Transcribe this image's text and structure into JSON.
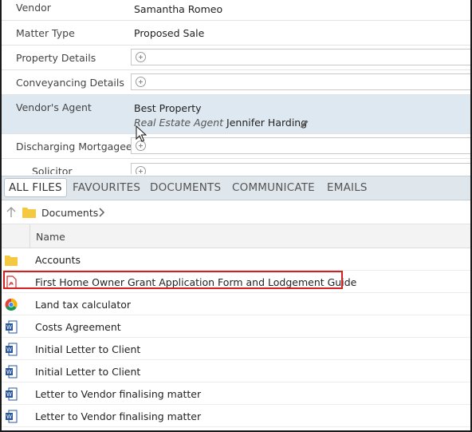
{
  "details": {
    "vendor_label": "Vendor",
    "vendor_value": "Samantha Romeo",
    "matter_type_label": "Matter Type",
    "matter_type_value": "Proposed Sale",
    "property_details_label": "Property Details",
    "conveyancing_details_label": "Conveyancing Details",
    "vendors_agent_label": "Vendor's Agent",
    "vendors_agent_company": "Best Property",
    "vendors_agent_role": "Real Estate Agent",
    "vendors_agent_person": "Jennifer Harding",
    "discharging_mortgagee_label": "Discharging Mortgagee",
    "solicitor_label": "Solicitor"
  },
  "tabs": [
    "ALL FILES",
    "FAVOURITES",
    "DOCUMENTS",
    "COMMUNICATE",
    "EMAILS"
  ],
  "active_tab": "ALL FILES",
  "breadcrumb": {
    "folder": "Documents"
  },
  "table": {
    "name_header": "Name",
    "rows": [
      {
        "name": "Accounts",
        "icon": "folder-icon"
      },
      {
        "name": "First Home Owner Grant Application Form and Lodgement Guide",
        "icon": "pdf-icon"
      },
      {
        "name": "Land tax calculator",
        "icon": "chrome-icon"
      },
      {
        "name": "Costs Agreement",
        "icon": "word-doc-icon"
      },
      {
        "name": "Initial Letter to Client",
        "icon": "word-doc-icon"
      },
      {
        "name": "Initial Letter to Client",
        "icon": "word-doc-icon"
      },
      {
        "name": "Letter to Vendor finalising matter",
        "icon": "word-doc-icon"
      },
      {
        "name": "Letter to Vendor finalising matter",
        "icon": "word-doc-icon"
      }
    ]
  },
  "colors": {
    "highlight_row_bg": "#dde8f1",
    "tabs_bg": "#dfe6ec",
    "annotation_red": "#d42020",
    "folder_yellow": "#f5c842",
    "word_blue": "#2b579a",
    "pdf_red": "#d32f2f"
  }
}
